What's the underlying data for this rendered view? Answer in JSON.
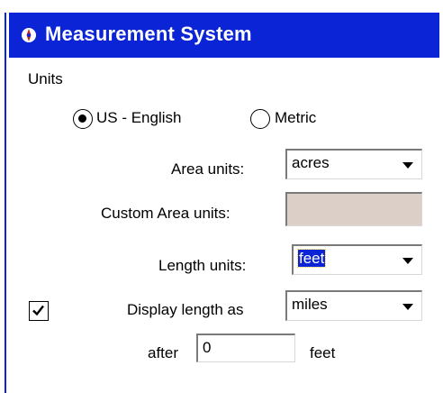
{
  "window": {
    "title": "Measurement System",
    "title_icon": "compass-icon"
  },
  "units_group": {
    "label": "Units",
    "options": [
      {
        "label": "US - English",
        "selected": true
      },
      {
        "label": "Metric",
        "selected": false
      }
    ]
  },
  "area_units": {
    "label": "Area units:",
    "value": "acres"
  },
  "custom_area_units": {
    "label": "Custom Area units:",
    "value": ""
  },
  "length_units": {
    "label": "Length units:",
    "value": "feet"
  },
  "display_length": {
    "checked": true,
    "label": "Display length as",
    "value": "miles"
  },
  "after": {
    "label": "after",
    "value": "0",
    "suffix": "feet"
  },
  "colors": {
    "titlebar": "#0a24d6",
    "disabled_field": "#dccfc8"
  }
}
